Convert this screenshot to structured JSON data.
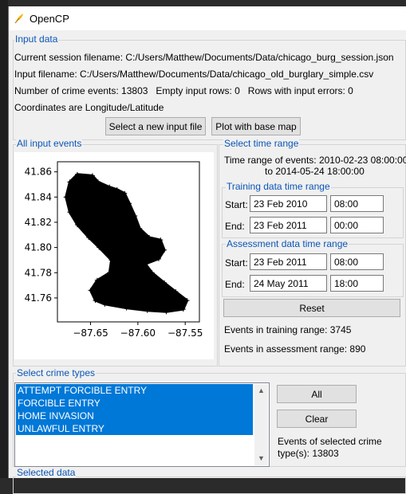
{
  "window": {
    "title": "OpenCP",
    "icon": "feather-icon"
  },
  "input_data": {
    "group_title": "Input data",
    "session_line": "Current session filename: C:/Users/Matthew/Documents/Data/chicago_burg_session.json",
    "input_line": "Input filename: C:/Users/Matthew/Documents/Data/chicago_old_burglary_simple.csv",
    "counts_line": "Number of crime events: 13803   Empty input rows: 0   Rows with input errors: 0",
    "coords_line": "Coordinates are Longitude/Latitude",
    "new_file_button": "Select a new input file",
    "plot_button": "Plot with base map"
  },
  "all_events": {
    "group_title": "All input events"
  },
  "chart_data": {
    "type": "scatter",
    "title": "",
    "xlabel": "",
    "ylabel": "",
    "xlim": [
      -87.685,
      -87.535
    ],
    "ylim": [
      41.741,
      41.868
    ],
    "xticks": [
      -87.65,
      -87.6,
      -87.55
    ],
    "xtick_labels": [
      "−87.65",
      "−87.60",
      "−87.55"
    ],
    "yticks": [
      41.76,
      41.78,
      41.8,
      41.82,
      41.84,
      41.86
    ],
    "ytick_labels": [
      "41.76",
      "41.78",
      "41.80",
      "41.82",
      "41.84",
      "41.86"
    ],
    "marker": "+",
    "color": "#000000",
    "point_count_shown": 13803,
    "approx_region_outline": [
      [
        -87.664,
        41.858
      ],
      [
        -87.648,
        41.857
      ],
      [
        -87.642,
        41.852
      ],
      [
        -87.63,
        41.848
      ],
      [
        -87.622,
        41.846
      ],
      [
        -87.614,
        41.843
      ],
      [
        -87.609,
        41.835
      ],
      [
        -87.603,
        41.825
      ],
      [
        -87.598,
        41.815
      ],
      [
        -87.588,
        41.808
      ],
      [
        -87.576,
        41.806
      ],
      [
        -87.572,
        41.798
      ],
      [
        -87.578,
        41.791
      ],
      [
        -87.592,
        41.787
      ],
      [
        -87.585,
        41.78
      ],
      [
        -87.572,
        41.772
      ],
      [
        -87.56,
        41.765
      ],
      [
        -87.548,
        41.758
      ],
      [
        -87.552,
        41.751
      ],
      [
        -87.57,
        41.749
      ],
      [
        -87.59,
        41.75
      ],
      [
        -87.612,
        41.752
      ],
      [
        -87.635,
        41.755
      ],
      [
        -87.645,
        41.758
      ],
      [
        -87.65,
        41.766
      ],
      [
        -87.643,
        41.774
      ],
      [
        -87.63,
        41.78
      ],
      [
        -87.628,
        41.79
      ],
      [
        -87.641,
        41.8
      ],
      [
        -87.652,
        41.808
      ],
      [
        -87.664,
        41.818
      ],
      [
        -87.672,
        41.828
      ],
      [
        -87.676,
        41.84
      ],
      [
        -87.672,
        41.852
      ]
    ]
  },
  "time_range": {
    "group_title": "Select time range",
    "range_line1": "Time range of events: 2010-02-23 08:00:00",
    "range_line2": "to 2014-05-24 18:00:00",
    "training": {
      "group_title": "Training data time range",
      "start_label": "Start:",
      "start_date": "23 Feb 2010",
      "start_time": "08:00",
      "end_label": "End:",
      "end_date": "23 Feb 2011",
      "end_time": "00:00"
    },
    "assessment": {
      "group_title": "Assessment data time range",
      "start_label": "Start:",
      "start_date": "23 Feb 2011",
      "start_time": "08:00",
      "end_label": "End:",
      "end_date": "24 May 2011",
      "end_time": "18:00"
    },
    "reset_button": "Reset",
    "training_count": "Events in training range: 3745",
    "assessment_count": "Events in assessment range: 890"
  },
  "crime_types": {
    "group_title": "Select crime types",
    "items": [
      "ATTEMPT FORCIBLE ENTRY",
      "FORCIBLE ENTRY",
      "HOME INVASION",
      "UNLAWFUL ENTRY"
    ],
    "all_button": "All",
    "clear_button": "Clear",
    "selected_line1": "Events of selected crime",
    "selected_line2": "type(s): 13803",
    "selection_color": "#0078d7"
  },
  "selected_data": {
    "group_title": "Selected data"
  },
  "accent": "#0a55b6"
}
